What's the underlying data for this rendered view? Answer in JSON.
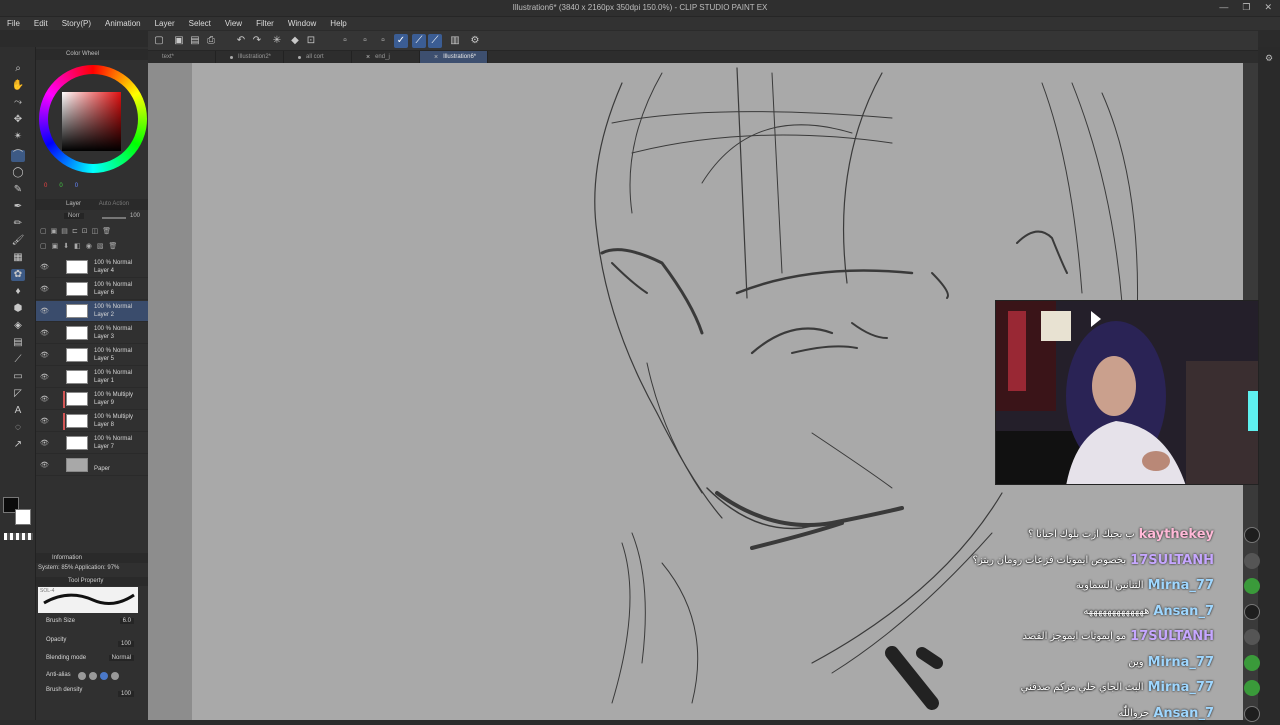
{
  "window": {
    "title": "Illustration6* (3840 x 2160px 350dpi 150.0%) - CLIP STUDIO PAINT EX",
    "controls": [
      "—",
      "❐",
      "✕"
    ]
  },
  "menu": [
    "File",
    "Edit",
    "Story(P)",
    "Animation",
    "Layer",
    "Select",
    "View",
    "Filter",
    "Window",
    "Help"
  ],
  "tabs": [
    {
      "label": "text*",
      "active": false
    },
    {
      "label": "Illustration2*",
      "active": false
    },
    {
      "label": "all cort",
      "active": false
    },
    {
      "label": "end_j",
      "active": false
    },
    {
      "label": "Illustration6*",
      "active": true
    }
  ],
  "color_panel": {
    "title": "Color Wheel",
    "rgb_values": [
      "0",
      "0",
      "0"
    ]
  },
  "layer_panel": {
    "title": "Layer",
    "tab2": "Auto Action",
    "blend_mode": "Norr",
    "opacity": "100",
    "layers": [
      {
        "mode": "100 % Normal",
        "name": "Layer 4",
        "selected": false,
        "clip": false
      },
      {
        "mode": "100 % Normal",
        "name": "Layer 6",
        "selected": false,
        "clip": false
      },
      {
        "mode": "100 % Normal",
        "name": "Layer 2",
        "selected": true,
        "clip": false
      },
      {
        "mode": "100 % Normal",
        "name": "Layer 3",
        "selected": false,
        "clip": false
      },
      {
        "mode": "100 % Normal",
        "name": "Layer 5",
        "selected": false,
        "clip": false
      },
      {
        "mode": "100 % Normal",
        "name": "Layer 1",
        "selected": false,
        "clip": false
      },
      {
        "mode": "100 % Multiply",
        "name": "Layer 9",
        "selected": false,
        "clip": true
      },
      {
        "mode": "100 % Multiply",
        "name": "Layer 8",
        "selected": false,
        "clip": true
      },
      {
        "mode": "100 % Normal",
        "name": "Layer 7",
        "selected": false,
        "clip": false
      },
      {
        "mode": "",
        "name": "Paper",
        "selected": false,
        "clip": false,
        "paper": true
      }
    ]
  },
  "information": {
    "title": "Information",
    "text": "System: 85%  Application: 97%"
  },
  "tool_property": {
    "title": "Tool Property",
    "brush_preview_label": "SOL-4",
    "brush_size_label": "Brush Size",
    "brush_size": "6.0",
    "opacity_label": "Opacity",
    "opacity": "100",
    "blending_label": "Blending mode",
    "blending": "Normal",
    "antialias_label": "Anti-alias",
    "density_label": "Brush density",
    "density": "100"
  },
  "chat": [
    {
      "user": "kaythekey",
      "color": "pink",
      "message": "ب بحبك ازت بلوك احيانا ؟",
      "avatar": "dark"
    },
    {
      "user": "17SULTANH",
      "color": "purple",
      "message": "بخصوص ايموتات فزعات رومان ريتز؟",
      "avatar": "gray"
    },
    {
      "user": "Mirna_77",
      "color": "blue",
      "message": "التنانين السماوية",
      "avatar": "green"
    },
    {
      "user": "Ansan_7",
      "color": "blue",
      "message": "هههههههههههههه",
      "avatar": "dark"
    },
    {
      "user": "17SULTANH",
      "color": "purple",
      "message": "مو ايموتات ايموجز القصد",
      "avatar": "gray"
    },
    {
      "user": "Mirna_77",
      "color": "blue",
      "message": "وين",
      "avatar": "green"
    },
    {
      "user": "Mirna_77",
      "color": "blue",
      "message": "البث الجاي خلي مزكم صدقني",
      "avatar": "green"
    },
    {
      "user": "Ansan_7",
      "color": "blue",
      "message": "حرواللّٰه",
      "avatar": "dark"
    }
  ],
  "colors": {
    "accent": "#3b5d94",
    "canvas": "#a9a9a9",
    "brush_red": "#e01010"
  }
}
